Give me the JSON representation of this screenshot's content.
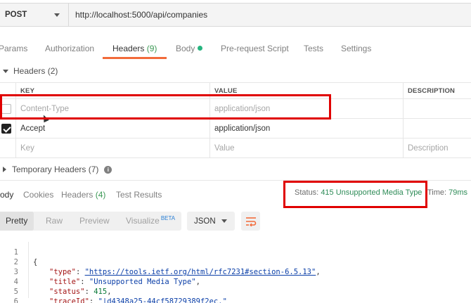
{
  "request": {
    "method": "POST",
    "url": "http://localhost:5000/api/companies"
  },
  "tabs": [
    {
      "label": "Params"
    },
    {
      "label": "Authorization"
    },
    {
      "label": "Headers",
      "count": "(9)"
    },
    {
      "label": "Body"
    },
    {
      "label": "Pre-request Script"
    },
    {
      "label": "Tests"
    },
    {
      "label": "Settings"
    }
  ],
  "headers_section": {
    "title": "Headers",
    "count": "(2)",
    "columns": {
      "key": "KEY",
      "value": "VALUE",
      "description": "DESCRIPTION"
    },
    "rows": [
      {
        "key": "Content-Type",
        "value": "application/json",
        "checked": false
      },
      {
        "key": "Accept",
        "value": "application/json",
        "checked": true
      }
    ],
    "placeholder": {
      "key": "Key",
      "value": "Value",
      "description": "Description"
    }
  },
  "temporary_headers": {
    "title": "Temporary Headers",
    "count": "(7)",
    "info_icon": "info-icon"
  },
  "response": {
    "tabs": [
      {
        "label": "Body"
      },
      {
        "label": "Cookies"
      },
      {
        "label": "Headers",
        "count": "(4)"
      },
      {
        "label": "Test Results"
      }
    ],
    "status_label": "Status:",
    "status_value": "415 Unsupported Media Type",
    "time_label": "Time:",
    "time_value": "79ms",
    "views": [
      "Pretty",
      "Raw",
      "Preview",
      "Visualize"
    ],
    "beta": "BETA",
    "format": "JSON",
    "wrap_icon": "wrap-lines-icon"
  },
  "code": {
    "line_numbers": [
      "1",
      "2",
      "3",
      "4",
      "5",
      "6"
    ],
    "open_brace": "{",
    "close_brace": "}",
    "type_key": "\"type\"",
    "type_value": "\"https://tools.ietf.org/html/rfc7231#section-6.5.13\"",
    "title_key": "\"title\"",
    "title_value": "\"Unsupported Media Type\"",
    "status_key": "\"status\"",
    "status_value": "415",
    "traceid_key": "\"traceId\"",
    "traceid_value": "\"|d4348a25-44cf58729389f2ec.\""
  },
  "colors": {
    "accent": "#f26b3a",
    "annotation": "#e00000",
    "success": "#2e8b57"
  }
}
